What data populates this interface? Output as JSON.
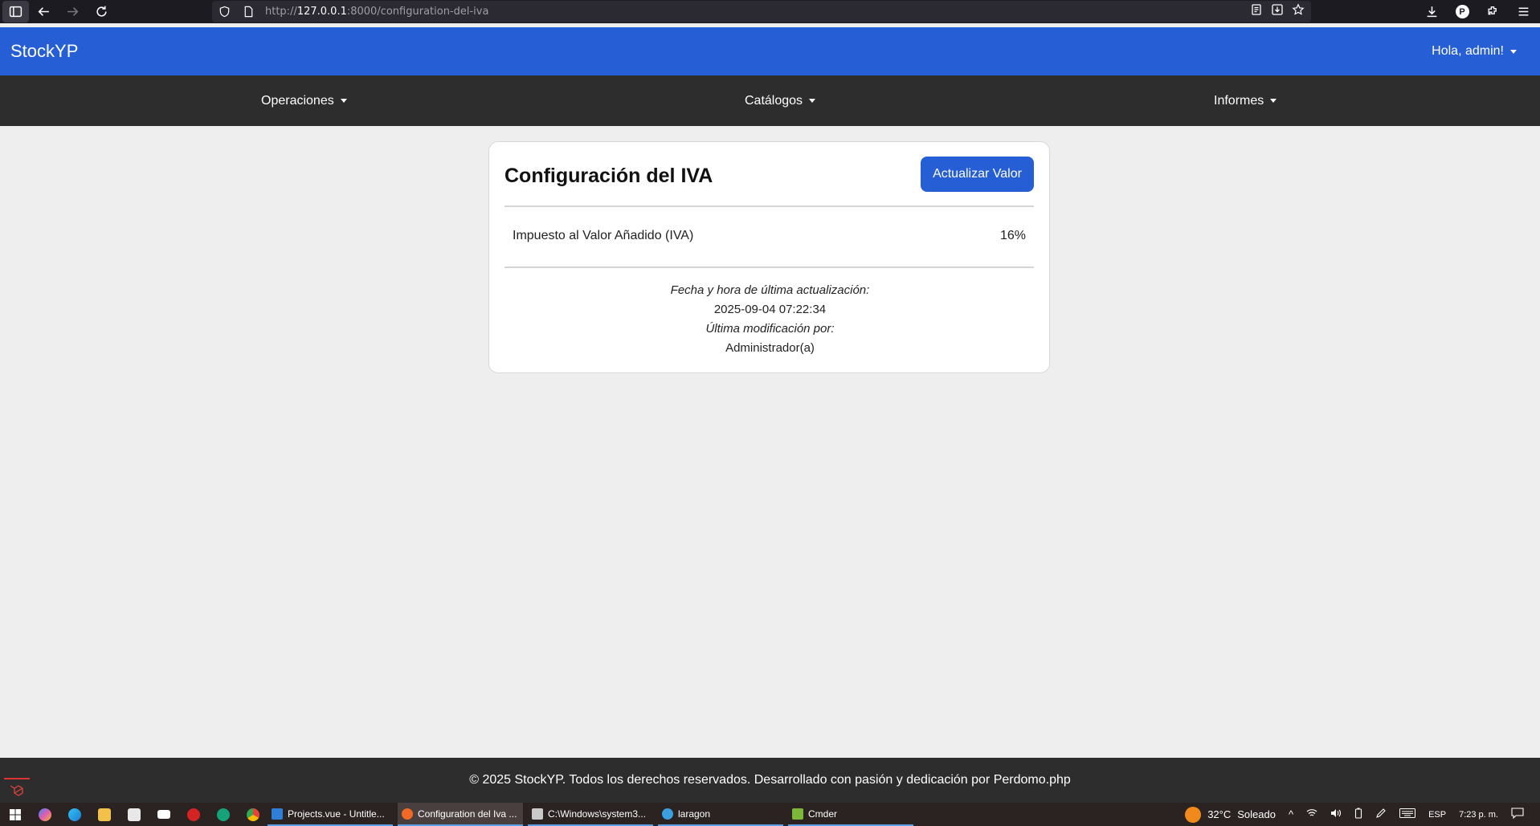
{
  "browser": {
    "url_prefix": "http://",
    "url_host": "127.0.0.1",
    "url_rest": ":8000/configuration-del-iva",
    "profile_initial": "P"
  },
  "app": {
    "brand": "StockYP",
    "user_greeting": "Hola, admin!"
  },
  "subnav": {
    "items": [
      {
        "label": "Operaciones"
      },
      {
        "label": "Catálogos"
      },
      {
        "label": "Informes"
      }
    ]
  },
  "card": {
    "title": "Configuración del IVA",
    "update_button": "Actualizar Valor",
    "tax_label": "Impuesto al Valor Añadido (IVA)",
    "tax_value": "16%",
    "updated_label": "Fecha y hora de última actualización:",
    "updated_value": "2025-09-04 07:22:34",
    "modified_by_label": "Última modificación por:",
    "modified_by_value": "Administrador(a)"
  },
  "footer": {
    "text": "© 2025 StockYP. Todos los derechos reservados. Desarrollado con pasión y dedicación por Perdomo.php"
  },
  "taskbar": {
    "apps": [
      {
        "label": "Projects.vue - Untitle...",
        "color": "#2f7fd8"
      },
      {
        "label": "Configuration del Iva ...",
        "color": "#f06a25"
      },
      {
        "label": "C:\\Windows\\system3...",
        "color": "#c9c9c9"
      },
      {
        "label": "laragon",
        "color": "#3aa0e0"
      },
      {
        "label": "Cmder",
        "color": "#7bb83a"
      }
    ],
    "weather_temp": "32°C",
    "weather_desc": "Soleado",
    "language": "ESP",
    "time": "7:23 p. m."
  },
  "colors": {
    "primary": "#255ed5",
    "nav_dark": "#2d2d2d",
    "page_bg": "#eeeeee"
  }
}
